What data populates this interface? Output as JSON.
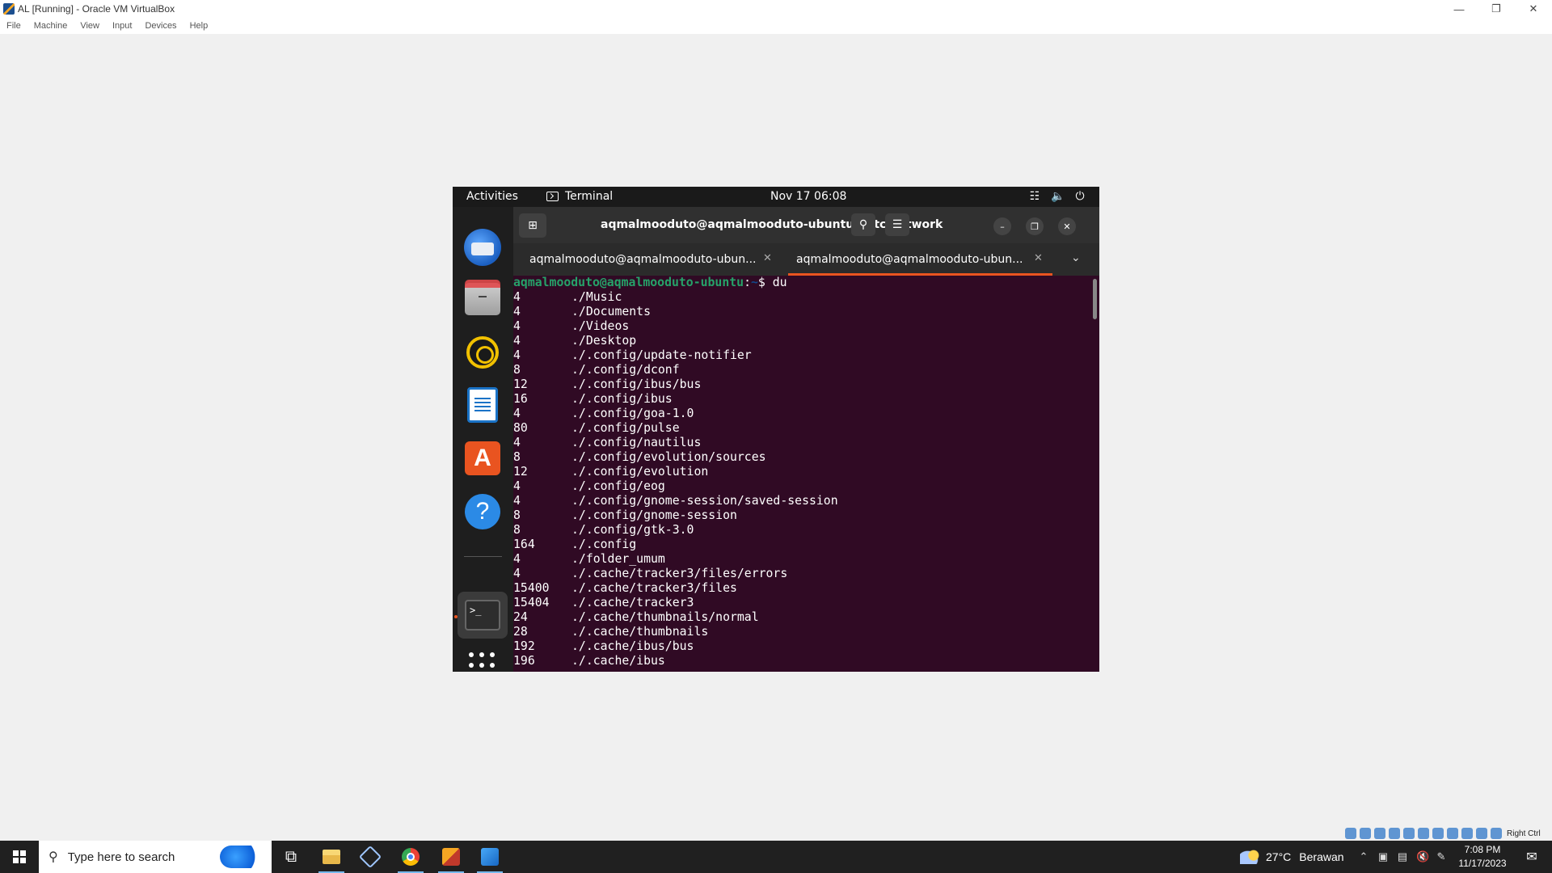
{
  "vbox": {
    "title": "AL [Running] - Oracle VM VirtualBox",
    "menu": [
      "File",
      "Machine",
      "View",
      "Input",
      "Devices",
      "Help"
    ],
    "host_key": "Right Ctrl"
  },
  "gnome": {
    "activities": "Activities",
    "app_menu": "Terminal",
    "clock": "Nov 17  06:08"
  },
  "terminal": {
    "title": "aqmalmooduto@aqmalmooduto-ubuntu: /etc/network",
    "tabs": [
      {
        "label": "aqmalmooduto@aqmalmooduto-ubun...",
        "active": false
      },
      {
        "label": "aqmalmooduto@aqmalmooduto-ubun...",
        "active": true
      }
    ],
    "prompt_user": "aqmalmooduto@aqmalmooduto-ubuntu",
    "prompt_sep": ":",
    "prompt_path": "~",
    "prompt_end": "$ ",
    "command": "du",
    "output": [
      {
        "size": "4",
        "path": "./Music"
      },
      {
        "size": "4",
        "path": "./Documents"
      },
      {
        "size": "4",
        "path": "./Videos"
      },
      {
        "size": "4",
        "path": "./Desktop"
      },
      {
        "size": "4",
        "path": "./.config/update-notifier"
      },
      {
        "size": "8",
        "path": "./.config/dconf"
      },
      {
        "size": "12",
        "path": "./.config/ibus/bus"
      },
      {
        "size": "16",
        "path": "./.config/ibus"
      },
      {
        "size": "4",
        "path": "./.config/goa-1.0"
      },
      {
        "size": "80",
        "path": "./.config/pulse"
      },
      {
        "size": "4",
        "path": "./.config/nautilus"
      },
      {
        "size": "8",
        "path": "./.config/evolution/sources"
      },
      {
        "size": "12",
        "path": "./.config/evolution"
      },
      {
        "size": "4",
        "path": "./.config/eog"
      },
      {
        "size": "4",
        "path": "./.config/gnome-session/saved-session"
      },
      {
        "size": "8",
        "path": "./.config/gnome-session"
      },
      {
        "size": "8",
        "path": "./.config/gtk-3.0"
      },
      {
        "size": "164",
        "path": "./.config"
      },
      {
        "size": "4",
        "path": "./folder_umum"
      },
      {
        "size": "4",
        "path": "./.cache/tracker3/files/errors"
      },
      {
        "size": "15400",
        "path": "./.cache/tracker3/files"
      },
      {
        "size": "15404",
        "path": "./.cache/tracker3"
      },
      {
        "size": "24",
        "path": "./.cache/thumbnails/normal"
      },
      {
        "size": "28",
        "path": "./.cache/thumbnails"
      },
      {
        "size": "192",
        "path": "./.cache/ibus/bus"
      },
      {
        "size": "196",
        "path": "./.cache/ibus"
      }
    ]
  },
  "taskbar": {
    "search_placeholder": "Type here to search",
    "weather_temp": "27°C",
    "weather_desc": "Berawan",
    "time": "7:08 PM",
    "date": "11/17/2023"
  }
}
